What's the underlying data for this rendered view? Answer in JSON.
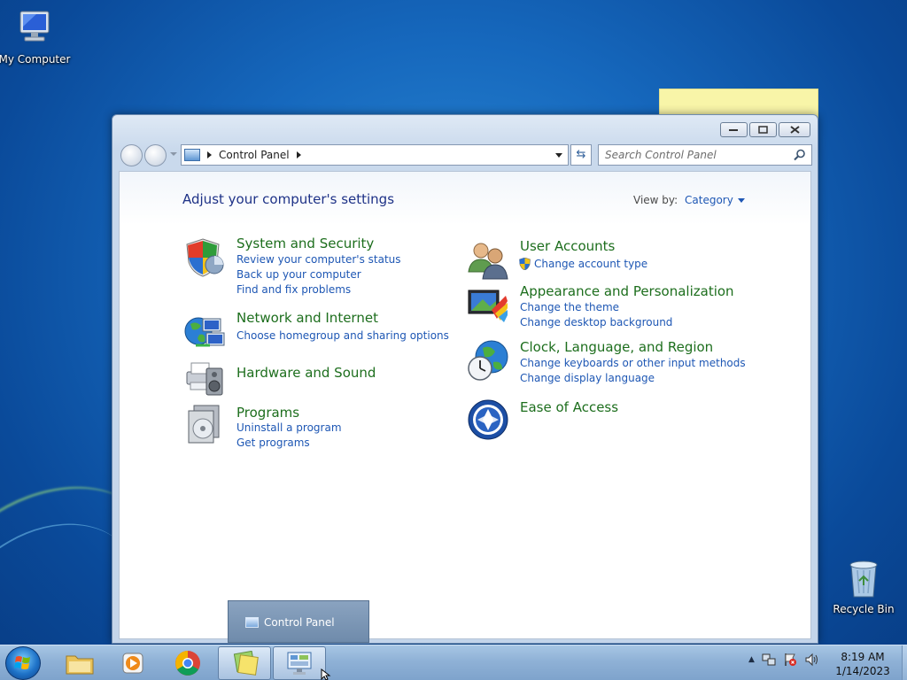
{
  "desktop": {
    "icons": [
      {
        "label": "My Computer"
      },
      {
        "label": "Recycle Bin"
      }
    ]
  },
  "window": {
    "address": {
      "segment": "Control Panel"
    },
    "search": {
      "placeholder": "Search Control Panel"
    },
    "heading": "Adjust your computer's settings",
    "view_by": {
      "label": "View by:",
      "value": "Category"
    },
    "categories": [
      {
        "title": "System and Security",
        "links": [
          "Review your computer's status",
          "Back up your computer",
          "Find and fix problems"
        ]
      },
      {
        "title": "Network and Internet",
        "links": [
          "Choose homegroup and sharing options"
        ]
      },
      {
        "title": "Hardware and Sound",
        "links": []
      },
      {
        "title": "Programs",
        "links": [
          "Uninstall a program",
          "Get programs"
        ]
      },
      {
        "title": "User Accounts",
        "links": [
          "Change account type"
        ]
      },
      {
        "title": "Appearance and Personalization",
        "links": [
          "Change the theme",
          "Change desktop background"
        ]
      },
      {
        "title": "Clock, Language, and Region",
        "links": [
          "Change keyboards or other input methods",
          "Change display language"
        ]
      },
      {
        "title": "Ease of Access",
        "links": []
      }
    ]
  },
  "taskbar": {
    "tooltip": "Control Panel",
    "clock": {
      "time": "8:19 AM",
      "date": "1/14/2023"
    }
  },
  "colors": {
    "category_title": "#1d6e1d",
    "link": "#1e57b4",
    "heading": "#1e3287"
  }
}
